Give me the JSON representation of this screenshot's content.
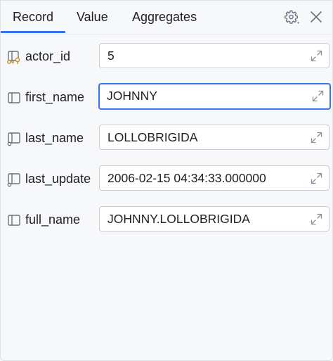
{
  "tabs": [
    {
      "label": "Record",
      "active": true
    },
    {
      "label": "Value",
      "active": false
    },
    {
      "label": "Aggregates",
      "active": false
    }
  ],
  "toolbar": {
    "settings_icon": "gear-icon",
    "close_icon": "close-icon"
  },
  "fields": [
    {
      "name": "actor_id",
      "value": "5",
      "icon": "primary-key-column-icon",
      "focused": false
    },
    {
      "name": "first_name",
      "value": "JOHNNY",
      "icon": "column-icon",
      "focused": true
    },
    {
      "name": "last_name",
      "value": "LOLLOBRIGIDA",
      "icon": "column-not-null-icon",
      "focused": false
    },
    {
      "name": "last_update",
      "value": "2006-02-15 04:34:33.000000",
      "icon": "column-not-null-icon",
      "focused": false
    },
    {
      "name": "full_name",
      "value": "JOHNNY.LOLLOBRIGIDA",
      "icon": "column-icon",
      "focused": false
    }
  ],
  "colors": {
    "accent": "#3574f0",
    "icon": "#6c707e",
    "key": "#c78f29"
  }
}
